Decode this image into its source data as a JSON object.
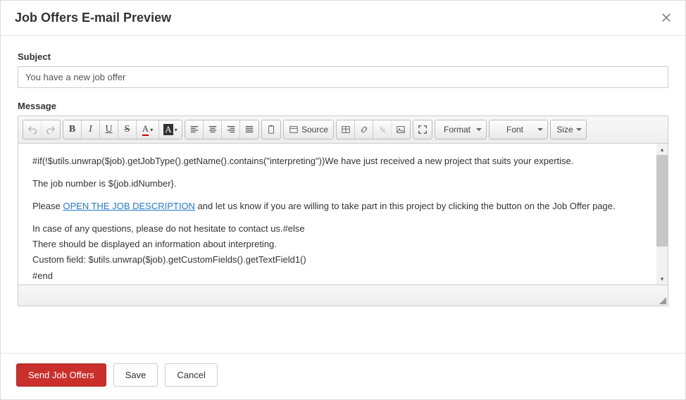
{
  "header": {
    "title": "Job Offers E-mail Preview"
  },
  "form": {
    "subject_label": "Subject",
    "subject_value": "You have a new job offer",
    "message_label": "Message"
  },
  "toolbar": {
    "source_label": "Source",
    "format_label": "Format",
    "font_label": "Font",
    "size_label": "Size"
  },
  "editor": {
    "line1_a": "#if(!$utils.unwrap($job).getJobType().getName().contains(\"interpreting\"))We have just received a new project that suits your expertise.",
    "line2": "The job number is ${job.idNumber}.",
    "line3_a": "Please ",
    "line3_link": "OPEN THE JOB DESCRIPTION",
    "line3_b": " and let us know if you are willing to take part in this project by clicking the button on the Job Offer page.",
    "line4": "In case of any questions, please do not hesitate to contact us.#else",
    "line5": "There should be displayed an information about interpreting.",
    "line6": "Custom field: $utils.unwrap($job).getCustomFields().getTextField1()",
    "line7": "#end"
  },
  "footer": {
    "send_label": "Send Job Offers",
    "save_label": "Save",
    "cancel_label": "Cancel"
  }
}
